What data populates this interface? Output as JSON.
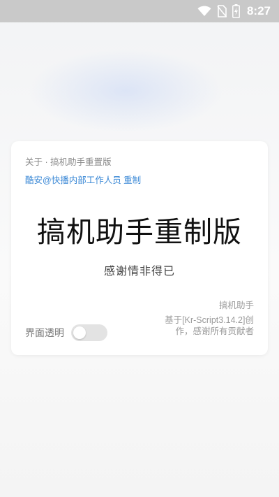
{
  "status_bar": {
    "time": "8:27",
    "icons": [
      "wifi-icon",
      "no-sim-icon",
      "battery-charging-icon"
    ]
  },
  "about_card": {
    "about_line": "关于 · 搞机助手重置版",
    "author_link": "酷安@快播内部工作人员 重制",
    "title": "搞机助手重制版",
    "subtitle": "感谢情非得已",
    "app_name": "搞机助手",
    "credit": "基于[Kr-Script3.14.2]创作，感谢所有贡献者",
    "transparent_toggle": {
      "label": "界面透明",
      "enabled": false
    }
  }
}
